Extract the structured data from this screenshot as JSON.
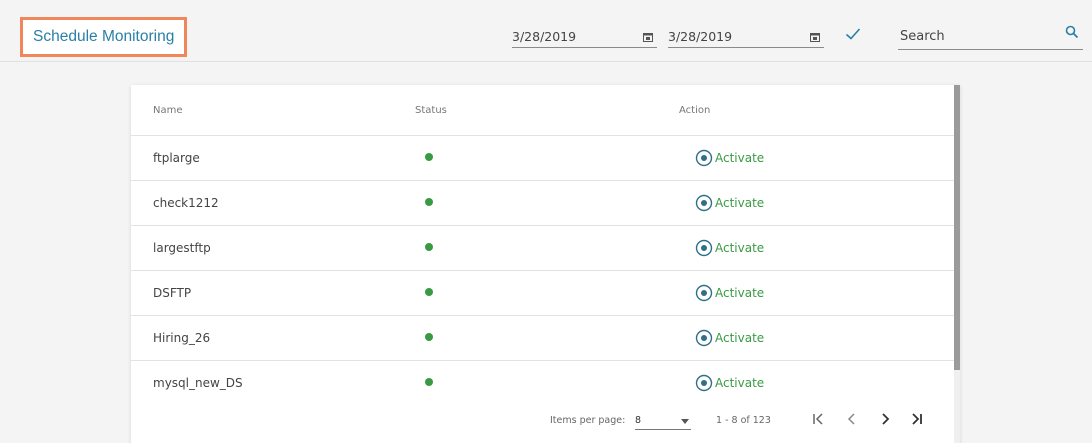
{
  "header": {
    "title": "Schedule Monitoring",
    "from_date": "3/28/2019",
    "to_date": "3/28/2019",
    "search_placeholder": "Search"
  },
  "table": {
    "columns": [
      "Name",
      "Status",
      "Action"
    ],
    "rows": [
      {
        "name": "ftplarge",
        "status": "active",
        "action": "Activate"
      },
      {
        "name": "check1212",
        "status": "active",
        "action": "Activate"
      },
      {
        "name": "largestftp",
        "status": "active",
        "action": "Activate"
      },
      {
        "name": "DSFTP",
        "status": "active",
        "action": "Activate"
      },
      {
        "name": "Hiring_26",
        "status": "active",
        "action": "Activate"
      },
      {
        "name": "mysql_new_DS",
        "status": "active",
        "action": "Activate"
      }
    ]
  },
  "paginator": {
    "items_per_page_label": "Items per page:",
    "items_per_page": "8",
    "range": "1 - 8 of 123"
  },
  "icons": {
    "calendar": "calendar-icon",
    "apply": "check-icon",
    "search": "search-icon",
    "activate": "radio-target-icon",
    "first": "first-page-icon",
    "prev": "previous-page-icon",
    "next": "next-page-icon",
    "last": "last-page-icon"
  },
  "colors": {
    "title": "#2a7fa6",
    "highlight_border": "#f0875a",
    "status_active": "#3a9a44",
    "action": "#3a9a44"
  }
}
